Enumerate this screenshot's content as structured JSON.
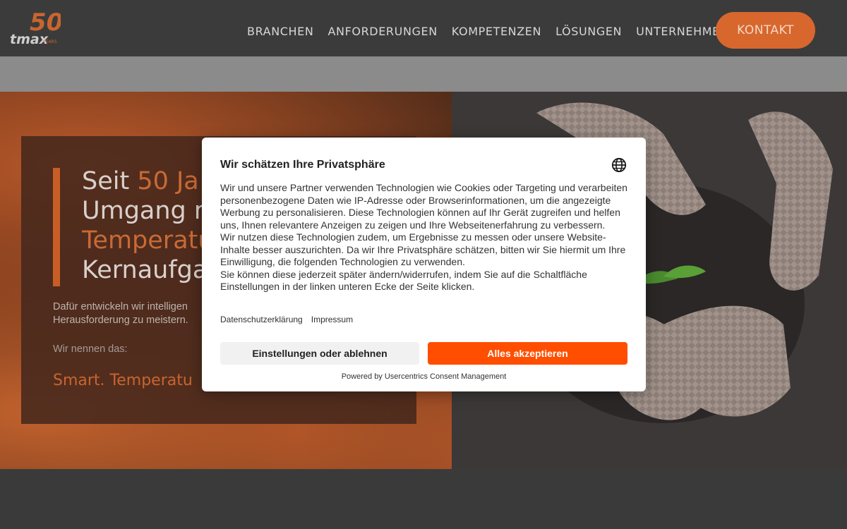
{
  "header": {
    "logo_number": "50",
    "logo_brand": "tmax",
    "logo_years": "YEARS",
    "nav": [
      "BRANCHEN",
      "ANFORDERUNGEN",
      "KOMPETENZEN",
      "LÖSUNGEN",
      "UNTERNEHMEN"
    ],
    "contact_label": "KONTAKT",
    "accent_color": "#d8672d"
  },
  "hero": {
    "headline_line1_a": "Seit ",
    "headline_line1_b": "50 Ja",
    "headline_line2": "Umgang m",
    "headline_line3": "Temperatu",
    "headline_line4": "Kernaufga",
    "text_line1": "Dafür entwickeln wir intelligen",
    "text_line2": "Herausforderung zu meistern.",
    "sub": "Wir nennen das:",
    "slogan": "Smart. Temperatu"
  },
  "consent": {
    "title": "Wir schätzen Ihre Privatsphäre",
    "language_icon": "globe-icon",
    "paragraphs": [
      "Wir und unsere Partner verwenden Technologien wie Cookies oder Targeting und verarbeiten personenbezogene Daten wie IP-Adresse oder Browserinformationen, um die angezeigte Werbung zu personalisieren. Diese Technologien können auf Ihr Gerät zugreifen und helfen uns, Ihnen relevantere Anzeigen zu zeigen und Ihre Webseitenerfahrung zu verbessern.",
      "Wir nutzen diese Technologien zudem, um Ergebnisse zu messen oder unsere Website-Inhalte besser auszurichten. Da wir Ihre Privatsphäre schätzen, bitten wir Sie hiermit um Ihre Einwilligung, die folgenden Technologien zu verwenden.",
      "Sie können diese jederzeit später ändern/widerrufen, indem Sie auf die Schaltfläche Einstellungen in der linken unteren Ecke der Seite klicken."
    ],
    "links": [
      "Datenschutzerklärung",
      "Impressum"
    ],
    "deny_label": "Einstellungen oder ablehnen",
    "accept_label": "Alles akzeptieren",
    "accept_color": "#ff4e00",
    "powered_by": "Powered by Usercentrics Consent Management"
  }
}
